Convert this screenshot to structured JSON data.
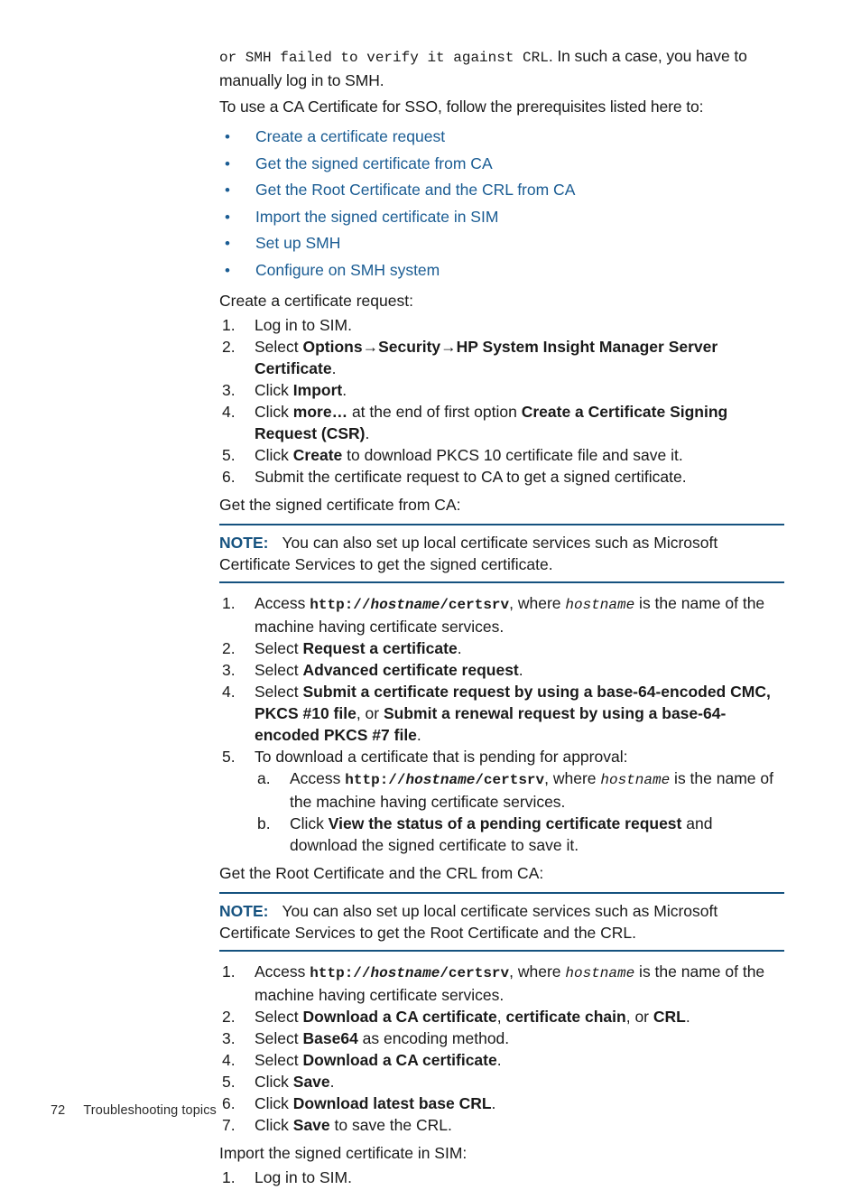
{
  "document": {
    "footer": {
      "page_number": "72",
      "chapter_title": "Troubleshooting topics"
    },
    "colors": {
      "link": "#1a5c93",
      "note_accent": "#15527f",
      "body_text": "#1a1a1a"
    },
    "intro": {
      "mono_lead": "or SMH failed to verify it against CRL",
      "sentence_tail": ". In such a case, you have to manually log in to SMH.",
      "prereq_intro": "To use a CA Certificate for SSO, follow the prerequisites listed here to:"
    },
    "prereq_links": [
      "Create a certificate request",
      "Get the signed certificate from CA",
      "Get the Root Certificate and the CRL from CA",
      "Import the signed certificate in SIM",
      "Set up SMH",
      "Configure on SMH system"
    ],
    "sections": {
      "create_request": {
        "heading": "Create a certificate request:",
        "steps": {
          "s1": "Log in to SIM.",
          "s2_pre": "Select ",
          "s2_b1": "Options",
          "s2_arrow1": "→",
          "s2_b2": "Security",
          "s2_arrow2": "→",
          "s2_b3": "HP System Insight Manager Server Certificate",
          "s2_post": ".",
          "s3_pre": "Click ",
          "s3_b": "Import",
          "s3_post": ".",
          "s4_pre": "Click ",
          "s4_b1": "more…",
          "s4_mid": " at the end of first option ",
          "s4_b2": "Create a Certificate Signing Request (CSR)",
          "s4_post": ".",
          "s5_pre": "Click ",
          "s5_b": "Create",
          "s5_post": " to download PKCS 10 certificate file and save it.",
          "s6": "Submit the certificate request to CA to get a signed certificate."
        }
      },
      "get_signed": {
        "heading": "Get the signed certificate from CA:",
        "note": {
          "label": "NOTE:",
          "body": "You can also set up local certificate services such as Microsoft Certificate Services to get the signed certificate."
        },
        "steps": {
          "s1_pre": "Access ",
          "s1_url_scheme": "http://",
          "s1_url_host": "hostname",
          "s1_url_path": "/certsrv",
          "s1_mid": ", where ",
          "s1_var": "hostname",
          "s1_post": " is the name of the machine having certificate services.",
          "s2_pre": "Select ",
          "s2_b": "Request a certificate",
          "s2_post": ".",
          "s3_pre": "Select ",
          "s3_b": "Advanced certificate request",
          "s3_post": ".",
          "s4_pre": "Select ",
          "s4_b1": "Submit a certificate request by using a base-64-encoded CMC, PKCS #10 file",
          "s4_mid": ", or ",
          "s4_b2": "Submit a renewal request by using a base-64-encoded PKCS #7 file",
          "s4_post": ".",
          "s5": "To download a certificate that is pending for approval:",
          "s5a_pre": "Access ",
          "s5a_url_scheme": "http://",
          "s5a_url_host": "hostname",
          "s5a_url_path": "/certsrv",
          "s5a_mid": ", where ",
          "s5a_var": "hostname",
          "s5a_post": " is the name of the machine having certificate services.",
          "s5b_pre": "Click ",
          "s5b_b": "View the status of a pending certificate request",
          "s5b_post": " and download the signed certificate to save it."
        }
      },
      "get_root": {
        "heading": "Get the Root Certificate and the CRL from CA:",
        "note": {
          "label": "NOTE:",
          "body": "You can also set up local certificate services such as Microsoft Certificate Services to get the Root Certificate and the CRL."
        },
        "steps": {
          "s1_pre": "Access ",
          "s1_url_scheme": "http://",
          "s1_url_host": "hostname",
          "s1_url_path": "/certsrv",
          "s1_mid": ", where ",
          "s1_var": "hostname",
          "s1_post": " is the name of the machine having certificate services.",
          "s2_pre": "Select ",
          "s2_b1": "Download a CA certificate",
          "s2_mid1": ", ",
          "s2_b2": "certificate chain",
          "s2_mid2": ", or ",
          "s2_b3": "CRL",
          "s2_post": ".",
          "s3_pre": "Select ",
          "s3_b": "Base64",
          "s3_post": " as encoding method.",
          "s4_pre": "Select ",
          "s4_b": "Download a CA certificate",
          "s4_post": ".",
          "s5_pre": "Click ",
          "s5_b": "Save",
          "s5_post": ".",
          "s6_pre": "Click ",
          "s6_b": "Download latest base CRL",
          "s6_post": ".",
          "s7_pre": "Click ",
          "s7_b": "Save",
          "s7_post": " to save the CRL."
        }
      },
      "import_sim": {
        "heading": "Import the signed certificate in SIM:",
        "steps": {
          "s1": "Log in to SIM."
        }
      }
    },
    "markers": {
      "n1": "1.",
      "n2": "2.",
      "n3": "3.",
      "n4": "4.",
      "n5": "5.",
      "n6": "6.",
      "n7": "7.",
      "a": "a.",
      "b": "b.",
      "bullet": "•"
    }
  }
}
